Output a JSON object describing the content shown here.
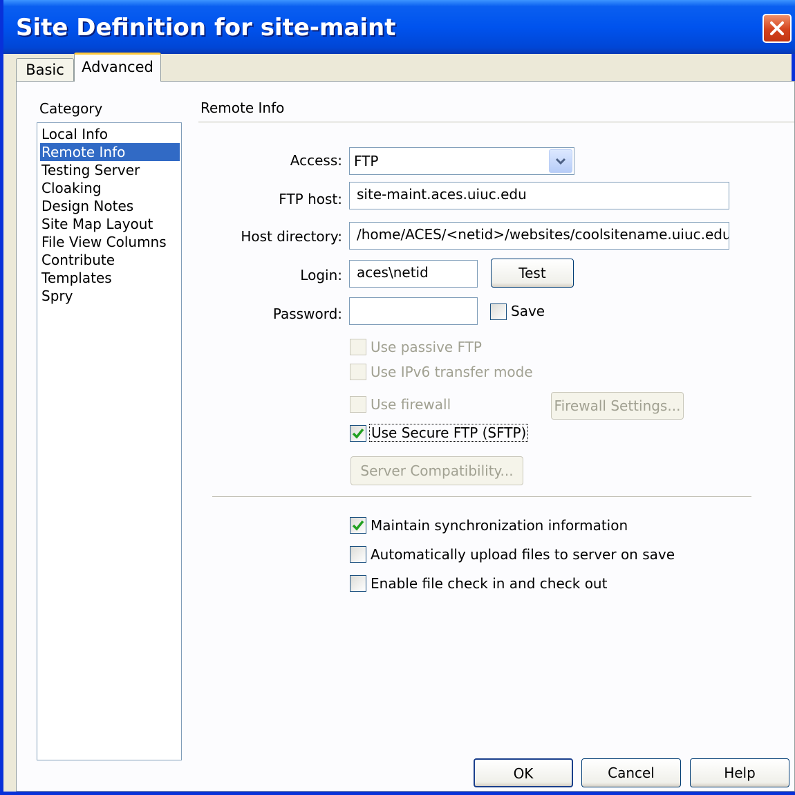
{
  "window": {
    "title": "Site Definition for site-maint",
    "close_icon": "close-icon"
  },
  "tabs": [
    {
      "label": "Basic",
      "active": false
    },
    {
      "label": "Advanced",
      "active": true
    }
  ],
  "category": {
    "heading": "Category",
    "items": [
      "Local Info",
      "Remote Info",
      "Testing Server",
      "Cloaking",
      "Design Notes",
      "Site Map Layout",
      "File View Columns",
      "Contribute",
      "Templates",
      "Spry"
    ],
    "selected": "Remote Info"
  },
  "section": {
    "title": "Remote Info"
  },
  "form": {
    "access_label": "Access:",
    "access_value": "FTP",
    "ftp_host_label": "FTP host:",
    "ftp_host_value": "site-maint.aces.uiuc.edu",
    "host_dir_label": "Host directory:",
    "host_dir_value": "/home/ACES/<netid>/websites/coolsitename.uiuc.edu",
    "login_label": "Login:",
    "login_value": "aces\\netid",
    "test_label": "Test",
    "password_label": "Password:",
    "password_value": "",
    "save_label": "Save",
    "save_checked": false
  },
  "options": {
    "passive_ftp": {
      "label": "Use passive FTP",
      "checked": false,
      "enabled": false
    },
    "ipv6": {
      "label": "Use IPv6 transfer mode",
      "checked": false,
      "enabled": false
    },
    "firewall": {
      "label": "Use firewall",
      "checked": false,
      "enabled": false
    },
    "firewall_settings_label": "Firewall Settings...",
    "sftp": {
      "label": "Use Secure FTP (SFTP)",
      "checked": true,
      "enabled": true
    },
    "server_compat_label": "Server Compatibility..."
  },
  "sync": {
    "maintain": {
      "label": "Maintain synchronization information",
      "checked": true
    },
    "auto_upload": {
      "label": "Automatically upload files to server on save",
      "checked": false
    },
    "checkin": {
      "label": "Enable file check in and check out",
      "checked": false
    }
  },
  "footer": {
    "ok_label": "OK",
    "cancel_label": "Cancel",
    "help_label": "Help"
  },
  "colors": {
    "titlebar": "#0053ee",
    "selection": "#316ac5",
    "check": "#21a121",
    "close": "#d4421c"
  }
}
